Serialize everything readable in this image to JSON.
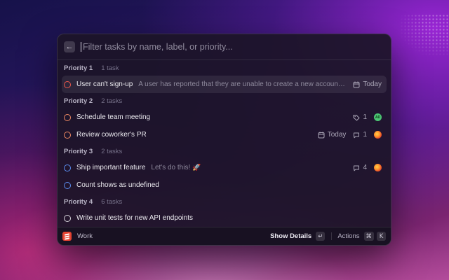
{
  "search": {
    "placeholder": "Filter tasks by name, label, or priority...",
    "back_icon": "←"
  },
  "sections": [
    {
      "title": "Priority 1",
      "count": "1 task"
    },
    {
      "title": "Priority 2",
      "count": "2 tasks"
    },
    {
      "title": "Priority 3",
      "count": "2 tasks"
    },
    {
      "title": "Priority 4",
      "count": "6 tasks"
    }
  ],
  "tasks": [
    {
      "title": "User can't sign-up",
      "description": "A user has reported that they are unable to create a new account on the website",
      "due": "Today",
      "priority": 1,
      "selected": true
    },
    {
      "title": "Schedule team meeting",
      "labels_count": "1",
      "avatar": "AD",
      "priority": 2
    },
    {
      "title": "Review coworker's PR",
      "due": "Today",
      "comments": "1",
      "priority": 2
    },
    {
      "title": "Ship important feature",
      "description": "Let's do this! 🚀",
      "comments": "4",
      "priority": 3
    },
    {
      "title": "Count shows as undefined",
      "priority": 3
    },
    {
      "title": "Write unit tests for new API endpoints",
      "priority": 4
    }
  ],
  "footer": {
    "workspace": "Work",
    "show_details": "Show Details",
    "enter_key": "↵",
    "actions": "Actions",
    "cmd_key": "⌘",
    "k_key": "K"
  },
  "colors": {
    "priority_1": "#f0584b",
    "priority_2": "#f08a63",
    "priority_3": "#5b8df0",
    "priority_4": "#d8d6dd",
    "app_logo": "#e44332"
  },
  "icons": {
    "back": "arrow-left-icon",
    "calendar": "calendar-icon",
    "label": "tag-icon",
    "comment": "comment-icon",
    "logo": "todoist-logo-icon"
  }
}
